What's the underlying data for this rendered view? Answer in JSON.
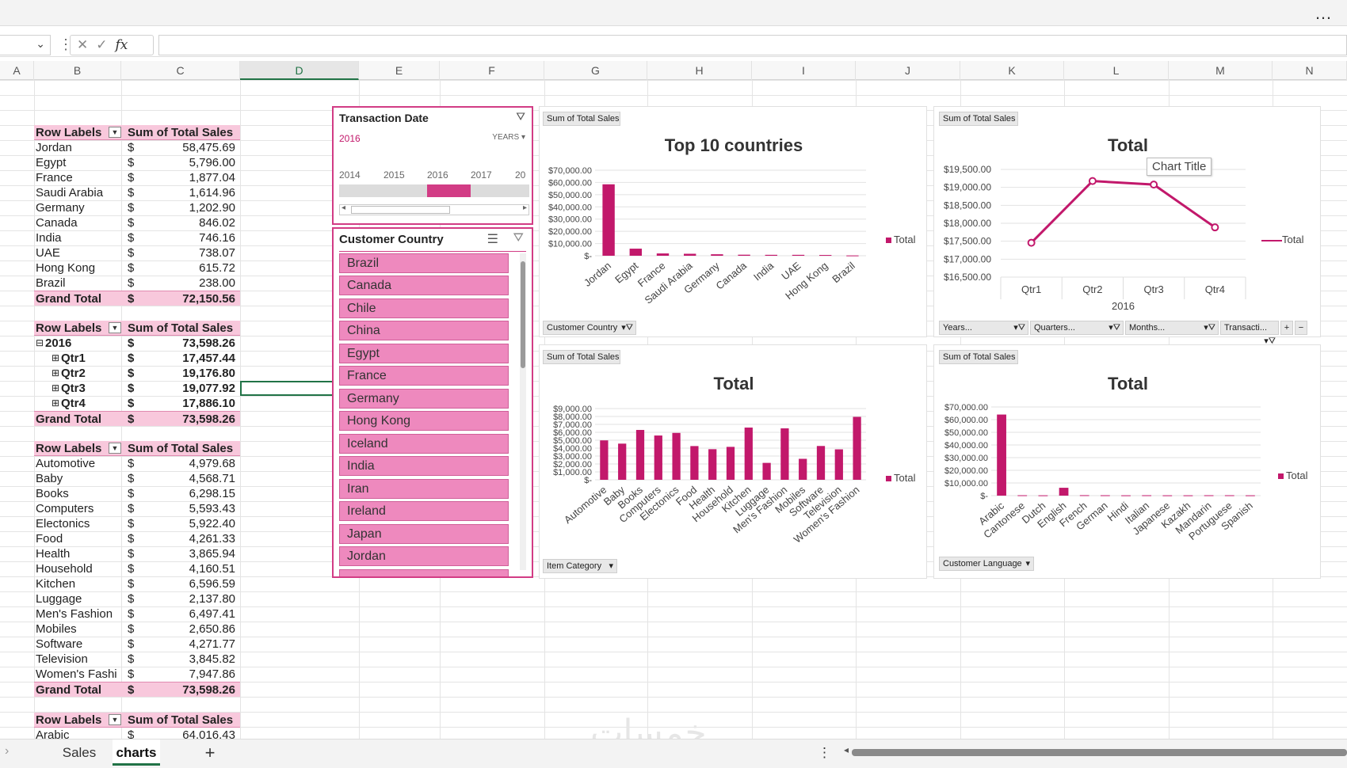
{
  "toolbar": {
    "more_icon": "…",
    "fx": "fx"
  },
  "columns": [
    "A",
    "B",
    "C",
    "D",
    "E",
    "F",
    "G",
    "H",
    "I",
    "J",
    "K",
    "L",
    "M",
    "N"
  ],
  "pivot1": {
    "h1": "Row Labels",
    "h2": "Sum of Total Sales",
    "rows": [
      {
        "l": "Jordan",
        "v": "58,475.69"
      },
      {
        "l": "Egypt",
        "v": "5,796.00"
      },
      {
        "l": "France",
        "v": "1,877.04"
      },
      {
        "l": "Saudi Arabia",
        "v": "1,614.96"
      },
      {
        "l": "Germany",
        "v": "1,202.90"
      },
      {
        "l": "Canada",
        "v": "846.02"
      },
      {
        "l": "India",
        "v": "746.16"
      },
      {
        "l": "UAE",
        "v": "738.07"
      },
      {
        "l": "Hong Kong",
        "v": "615.72"
      },
      {
        "l": "Brazil",
        "v": "238.00"
      }
    ],
    "gt": "Grand Total",
    "gtv": "72,150.56",
    "cur": "$"
  },
  "pivot2": {
    "h1": "Row Labels",
    "h2": "Sum of Total Sales",
    "rows": [
      {
        "l": "2016",
        "v": "73,598.26",
        "m": "⊟"
      },
      {
        "l": "Qtr1",
        "v": "17,457.44",
        "m": "⊞"
      },
      {
        "l": "Qtr2",
        "v": "19,176.80",
        "m": "⊞"
      },
      {
        "l": "Qtr3",
        "v": "19,077.92",
        "m": "⊞"
      },
      {
        "l": "Qtr4",
        "v": "17,886.10",
        "m": "⊞"
      }
    ],
    "gt": "Grand Total",
    "gtv": "73,598.26",
    "cur": "$"
  },
  "pivot3": {
    "h1": "Row Labels",
    "h2": "Sum of Total Sales",
    "rows": [
      {
        "l": "Automotive",
        "v": "4,979.68"
      },
      {
        "l": "Baby",
        "v": "4,568.71"
      },
      {
        "l": "Books",
        "v": "6,298.15"
      },
      {
        "l": "Computers",
        "v": "5,593.43"
      },
      {
        "l": "Electonics",
        "v": "5,922.40"
      },
      {
        "l": "Food",
        "v": "4,261.33"
      },
      {
        "l": "Health",
        "v": "3,865.94"
      },
      {
        "l": "Household",
        "v": "4,160.51"
      },
      {
        "l": "Kitchen",
        "v": "6,596.59"
      },
      {
        "l": "Luggage",
        "v": "2,137.80"
      },
      {
        "l": "Men's Fashion",
        "v": "6,497.41"
      },
      {
        "l": "Mobiles",
        "v": "2,650.86"
      },
      {
        "l": "Software",
        "v": "4,271.77"
      },
      {
        "l": "Television",
        "v": "3,845.82"
      },
      {
        "l": "Women's Fashi",
        "v": "7,947.86"
      }
    ],
    "gt": "Grand Total",
    "gtv": "73,598.26",
    "cur": "$"
  },
  "pivot4": {
    "h1": "Row Labels",
    "h2": "Sum of Total Sales",
    "rows": [
      {
        "l": "Arabic",
        "v": "64,016.43"
      }
    ],
    "cur": "$"
  },
  "timeline": {
    "title": "Transaction Date",
    "selected": "2016",
    "level": "YEARS",
    "years": [
      "2014",
      "2015",
      "2016",
      "2017",
      "20"
    ]
  },
  "slicer": {
    "title": "Customer Country",
    "items": [
      "Brazil",
      "Canada",
      "Chile",
      "China",
      "Egypt",
      "France",
      "Germany",
      "Hong Kong",
      "Iceland",
      "India",
      "Iran",
      "Ireland",
      "Japan",
      "Jordan"
    ]
  },
  "chart1": {
    "field": "Sum of Total Sales",
    "title": "Top 10 countries",
    "filter": "Customer Country",
    "legend": "Total"
  },
  "chart2": {
    "field": "Sum of Total Sales",
    "title": "Total",
    "tooltip": "Chart Title",
    "legend": "Total",
    "axis_group": "2016",
    "filters": [
      "Years...",
      "Quarters...",
      "Months...",
      "Transacti..."
    ]
  },
  "chart3": {
    "field": "Sum of Total Sales",
    "title": "Total",
    "filter": "Item Category",
    "legend": "Total"
  },
  "chart4": {
    "field": "Sum of Total Sales",
    "title": "Total",
    "filter": "Customer Language",
    "legend": "Total"
  },
  "chart_data": [
    {
      "type": "bar",
      "title": "Top 10 countries",
      "categories": [
        "Jordan",
        "Egypt",
        "France",
        "Saudi Arabia",
        "Germany",
        "Canada",
        "India",
        "UAE",
        "Hong Kong",
        "Brazil"
      ],
      "series": [
        {
          "name": "Total",
          "values": [
            58475.69,
            5796.0,
            1877.04,
            1614.96,
            1202.9,
            846.02,
            746.16,
            738.07,
            615.72,
            238.0
          ]
        }
      ],
      "yticks": [
        "$-",
        "$10,000.00",
        "$20,000.00",
        "$30,000.00",
        "$40,000.00",
        "$50,000.00",
        "$60,000.00",
        "$70,000.00"
      ],
      "ylim": [
        0,
        70000
      ]
    },
    {
      "type": "line",
      "title": "Total",
      "categories": [
        "Qtr1",
        "Qtr2",
        "Qtr3",
        "Qtr4"
      ],
      "series": [
        {
          "name": "Total",
          "values": [
            17457.44,
            19176.8,
            19077.92,
            17886.1
          ]
        }
      ],
      "yticks": [
        "$16,500.00",
        "$17,000.00",
        "$17,500.00",
        "$18,000.00",
        "$18,500.00",
        "$19,000.00",
        "$19,500.00"
      ],
      "ylim": [
        16500,
        19500
      ]
    },
    {
      "type": "bar",
      "title": "Total",
      "categories": [
        "Automotive",
        "Baby",
        "Books",
        "Computers",
        "Electonics",
        "Food",
        "Health",
        "Household",
        "Kitchen",
        "Luggage",
        "Men's Fashion",
        "Mobiles",
        "Software",
        "Television",
        "Women's Fashion"
      ],
      "series": [
        {
          "name": "Total",
          "values": [
            4979.68,
            4568.71,
            6298.15,
            5593.43,
            5922.4,
            4261.33,
            3865.94,
            4160.51,
            6596.59,
            2137.8,
            6497.41,
            2650.86,
            4271.77,
            3845.82,
            7947.86
          ]
        }
      ],
      "yticks": [
        "$-",
        "$1,000.00",
        "$2,000.00",
        "$3,000.00",
        "$4,000.00",
        "$5,000.00",
        "$6,000.00",
        "$7,000.00",
        "$8,000.00",
        "$9,000.00"
      ],
      "ylim": [
        0,
        9000
      ]
    },
    {
      "type": "bar",
      "title": "Total",
      "categories": [
        "Arabic",
        "Cantonese",
        "Dutch",
        "English",
        "French",
        "German",
        "Hindi",
        "Italian",
        "Japanese",
        "Kazakh",
        "Mandarin",
        "Portuguese",
        "Spanish"
      ],
      "series": [
        {
          "name": "Total",
          "values": [
            64016.43,
            300,
            250,
            6200,
            350,
            300,
            250,
            300,
            250,
            250,
            300,
            300,
            250
          ]
        }
      ],
      "yticks": [
        "$-",
        "$10,000.00",
        "$20,000.00",
        "$30,000.00",
        "$40,000.00",
        "$50,000.00",
        "$60,000.00",
        "$70,000.00"
      ],
      "ylim": [
        0,
        70000
      ]
    }
  ],
  "sheets": {
    "tabs": [
      "Sales",
      "charts"
    ],
    "add": "+",
    "menu": "⋮"
  },
  "watermark": "خمسات"
}
